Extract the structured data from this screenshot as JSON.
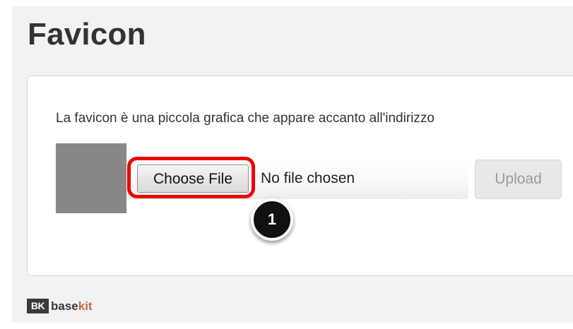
{
  "page": {
    "title": "Favicon"
  },
  "panel": {
    "description": "La favicon è una piccola grafica che appare accanto all'indirizzo"
  },
  "file_input": {
    "button_label": "Choose File",
    "status": "No file chosen"
  },
  "upload": {
    "label": "Upload"
  },
  "annotation": {
    "step_number": "1",
    "highlight_color": "#ee0000"
  },
  "footer": {
    "logo_text": "BK",
    "brand_part_1": "base",
    "brand_part_2": "kit"
  },
  "colors": {
    "background": "#f2f2f2",
    "panel": "#ffffff",
    "preview_placeholder": "#878787",
    "brand_accent": "#c76b3a"
  }
}
